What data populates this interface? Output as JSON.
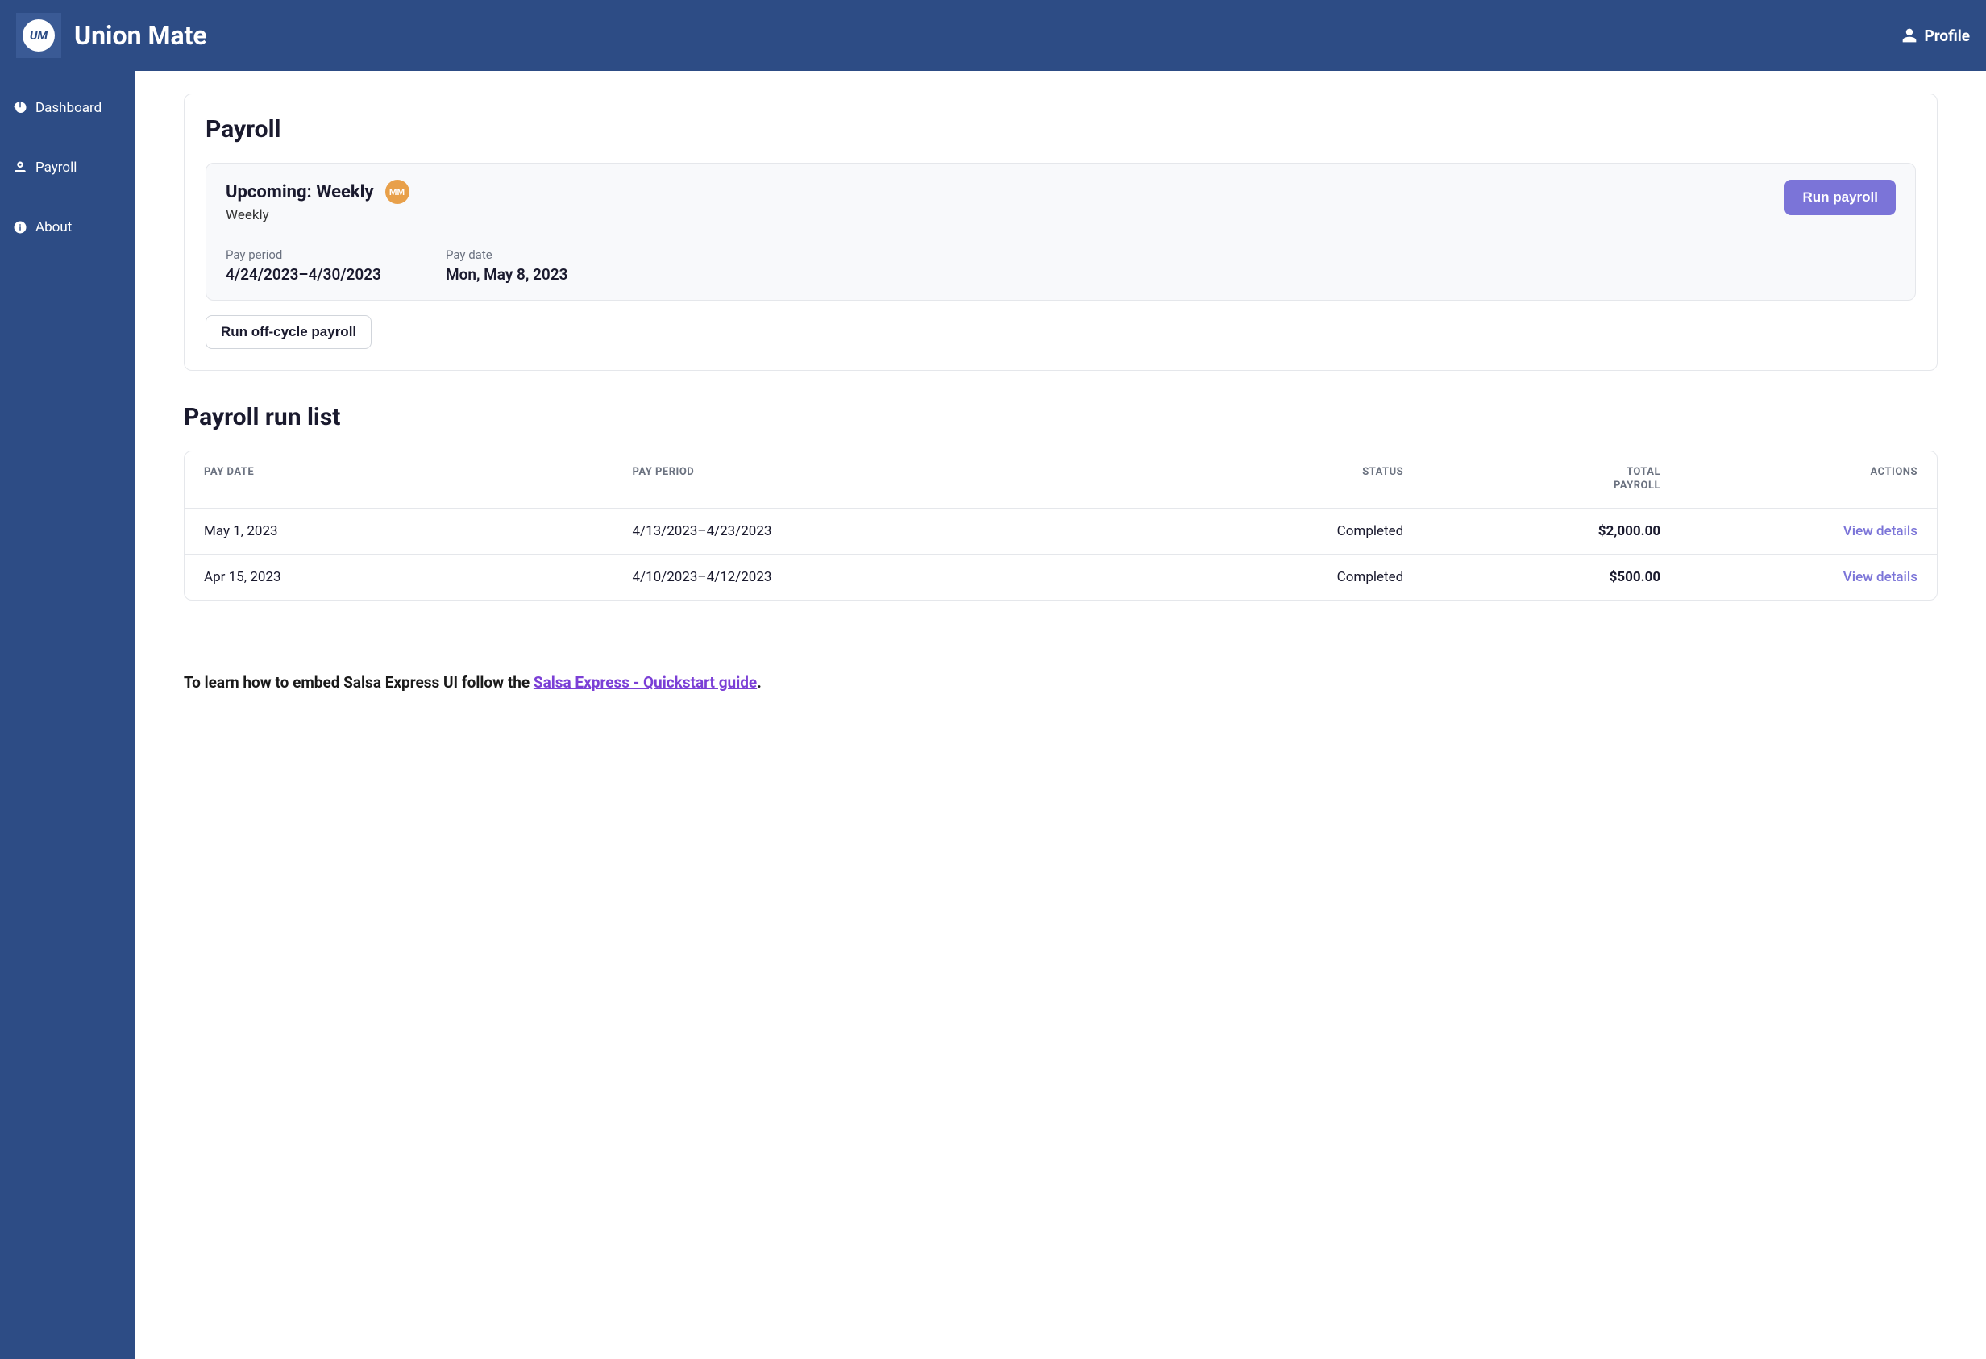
{
  "header": {
    "brand": "Union Mate",
    "logo_text": "UM",
    "profile_label": "Profile"
  },
  "sidebar": {
    "items": [
      {
        "label": "Dashboard"
      },
      {
        "label": "Payroll"
      },
      {
        "label": "About"
      }
    ]
  },
  "payroll": {
    "title": "Payroll",
    "upcoming": {
      "title": "Upcoming: Weekly",
      "subtitle": "Weekly",
      "avatar_initials": "MM",
      "pay_period_label": "Pay period",
      "pay_period_value": "4/24/2023–4/30/2023",
      "pay_date_label": "Pay date",
      "pay_date_value": "Mon, May 8, 2023",
      "run_button": "Run payroll"
    },
    "off_cycle_button": "Run off-cycle payroll"
  },
  "run_list": {
    "title": "Payroll run list",
    "columns": {
      "pay_date": "PAY DATE",
      "pay_period": "PAY PERIOD",
      "status": "STATUS",
      "total_line1": "TOTAL",
      "total_line2": "PAYROLL",
      "actions": "ACTIONS"
    },
    "rows": [
      {
        "pay_date": "May 1, 2023",
        "pay_period": "4/13/2023–4/23/2023",
        "status": "Completed",
        "total": "$2,000.00",
        "action": "View details"
      },
      {
        "pay_date": "Apr 15, 2023",
        "pay_period": "4/10/2023–4/12/2023",
        "status": "Completed",
        "total": "$500.00",
        "action": "View details"
      }
    ]
  },
  "footer": {
    "prefix": "To learn how to embed Salsa Express UI follow the ",
    "link": "Salsa Express - Quickstart guide",
    "suffix": "."
  }
}
